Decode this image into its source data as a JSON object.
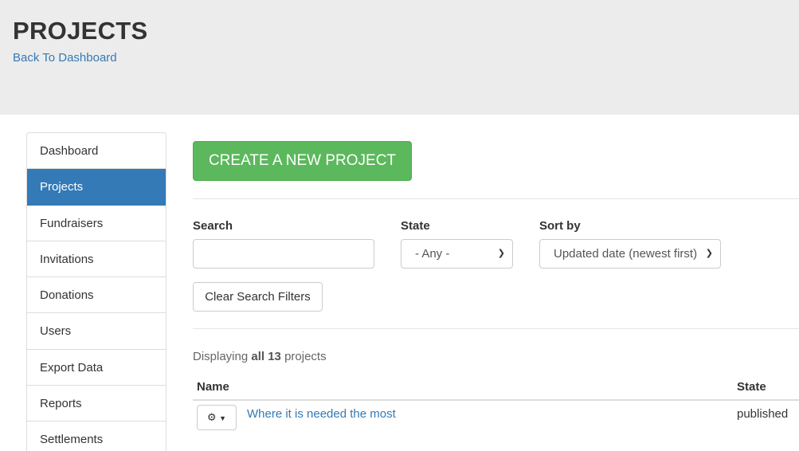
{
  "header": {
    "title": "PROJECTS",
    "back_link": "Back To Dashboard"
  },
  "sidebar": {
    "items": [
      {
        "label": "Dashboard"
      },
      {
        "label": "Projects",
        "active": true
      },
      {
        "label": "Fundraisers"
      },
      {
        "label": "Invitations"
      },
      {
        "label": "Donations"
      },
      {
        "label": "Users"
      },
      {
        "label": "Export Data"
      },
      {
        "label": "Reports"
      },
      {
        "label": "Settlements"
      }
    ]
  },
  "main": {
    "create_button": "CREATE A NEW PROJECT",
    "filters": {
      "search_label": "Search",
      "search_value": "",
      "state_label": "State",
      "state_selected": "- Any -",
      "sort_label": "Sort by",
      "sort_selected": "Updated date (newest first)",
      "clear_button": "Clear Search Filters"
    },
    "displaying": {
      "prefix": "Displaying",
      "count_text": "all 13",
      "suffix": "projects"
    },
    "table": {
      "columns": [
        "Name",
        "State"
      ],
      "rows": [
        {
          "name": "Where it is needed the most",
          "state": "published",
          "action_icon": "gear-icon"
        }
      ]
    }
  },
  "colors": {
    "primary": "#337ab7",
    "success": "#5cb85c",
    "header_bg": "#ececec"
  }
}
